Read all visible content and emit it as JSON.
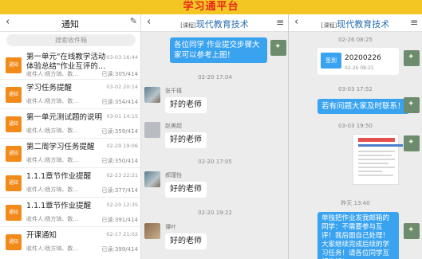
{
  "banner": {
    "title": "学习通平台"
  },
  "panel1": {
    "title": "通知",
    "back_icon": "‹",
    "edit_icon": "✎",
    "search_placeholder": "搜索收件箱",
    "items": [
      {
        "badge": "通知",
        "title": "第一单元\"在线教学活动体验总结\"作业互评的…",
        "date": "03-03 16:44",
        "meta": "收件人:杨方琦、数…",
        "read": "已读:305/414"
      },
      {
        "badge": "通知",
        "title": "学习任务提醒",
        "date": "03-02 20:14",
        "meta": "收件人:杨方琦、数…",
        "read": "已读:354/414"
      },
      {
        "badge": "通知",
        "title": "第一单元测试题的说明",
        "date": "03-01 14:15",
        "meta": "收件人:杨方琦、数…",
        "read": "已读:359/414"
      },
      {
        "badge": "通知",
        "title": "第二周学习任务提醒",
        "date": "02-29 19:06",
        "meta": "收件人:杨方琦、数…",
        "read": "已读:350/414"
      },
      {
        "badge": "通知",
        "title": "1.1.1章节作业提醒",
        "date": "02-23 22:21",
        "meta": "收件人:杨方琦、数…",
        "read": "已读:377/414"
      },
      {
        "badge": "通知",
        "title": "1.1.1章节作业提醒",
        "date": "02-20 12:35",
        "meta": "收件人:杨方琦、数…",
        "read": "已读:391/414"
      },
      {
        "badge": "通知",
        "title": "开课通知",
        "date": "02-17 21:02",
        "meta": "收件人:杨方琦、数…",
        "read": "已读:399/414"
      }
    ]
  },
  "panel2": {
    "tag": "[课程]",
    "title": "现代教育技术",
    "back_icon": "‹",
    "menu_icon": "≡",
    "top_message": "各位同学 作业提交步骤大家可以参考上图！",
    "time1": "02-20 17:04",
    "msg1_name": "张千禧",
    "msg1_text": "好的老师",
    "msg2_name": "赵美超",
    "msg2_text": "好的老师",
    "time2": "02-20 17:05",
    "msg3_name": "郝瑾怡",
    "msg3_text": "好的老师",
    "time3": "02-20 19:22",
    "msg4_name": "谭叶",
    "msg4_text": "好的老师"
  },
  "panel3": {
    "tag": "[课程]",
    "title": "现代教育技术",
    "back_icon": "‹",
    "menu_icon": "≡",
    "time1": "02-26 08:25",
    "sign_label": "签到",
    "sign_date": "20200226",
    "sign_time": "02-26 08:25",
    "time2": "03-03 17:52",
    "msg2": "若有问题大家及时联系！",
    "time3": "03-03 19:50",
    "time4": "昨天 13:40",
    "msg4": "单独把作业发我邮箱的同学：不需要参与互评！我后面自己处理！大家继续完成后续的学习任务！请各位同学互相告知！"
  }
}
